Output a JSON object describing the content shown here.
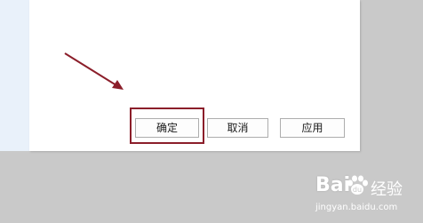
{
  "dialog": {
    "buttons": {
      "ok_label": "确定",
      "cancel_label": "取消",
      "apply_label": "应用"
    }
  },
  "annotation": {
    "color": "#8b1e2a",
    "shape": "arrow-and-box"
  },
  "watermark": {
    "brand": "Bai",
    "brand_suffix": "经验",
    "url": "jingyan.baidu.com",
    "icon": "paw-icon"
  }
}
